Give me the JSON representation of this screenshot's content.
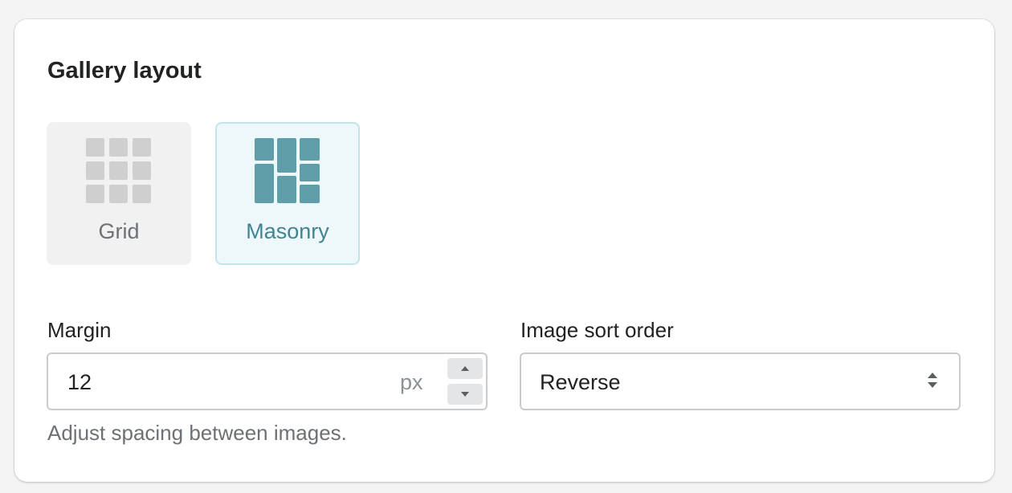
{
  "section": {
    "title": "Gallery layout"
  },
  "layout_options": [
    {
      "label": "Grid",
      "icon": "grid-icon",
      "selected": false
    },
    {
      "label": "Masonry",
      "icon": "masonry-icon",
      "selected": true
    }
  ],
  "margin": {
    "label": "Margin",
    "value": "12",
    "suffix": "px",
    "help_text": "Adjust spacing between images."
  },
  "sort_order": {
    "label": "Image sort order",
    "selected": "Reverse"
  },
  "colors": {
    "accent": "#3f8491",
    "accent_icon": "#5f9ea9",
    "unselected_icon": "#cfcfcf"
  }
}
